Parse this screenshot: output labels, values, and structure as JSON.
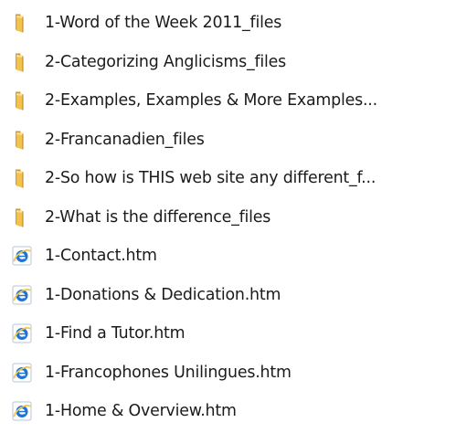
{
  "items": [
    {
      "name": "1-Word of the Week 2011_files",
      "icon": "folder-icon"
    },
    {
      "name": "2-Categorizing  Anglicisms_files",
      "icon": "folder-icon"
    },
    {
      "name": "2-Examples, Examples & More Examples...",
      "icon": "folder-icon"
    },
    {
      "name": "2-Francanadien_files",
      "icon": "folder-icon"
    },
    {
      "name": "2-So how is THIS web site any different_f...",
      "icon": "folder-icon"
    },
    {
      "name": "2-What is the difference_files",
      "icon": "folder-icon"
    },
    {
      "name": "1-Contact.htm",
      "icon": "internet-explorer-icon"
    },
    {
      "name": "1-Donations & Dedication.htm",
      "icon": "internet-explorer-icon"
    },
    {
      "name": "1-Find a Tutor.htm",
      "icon": "internet-explorer-icon"
    },
    {
      "name": "1-Francophones Unilingues.htm",
      "icon": "internet-explorer-icon"
    },
    {
      "name": "1-Home & Overview.htm",
      "icon": "internet-explorer-icon"
    }
  ],
  "colors": {
    "text": "#1b1b1b",
    "folder_front": "#f2c24f",
    "folder_back": "#d69a2a",
    "ie_blue": "#1e73d6",
    "ie_ring": "#f3c447",
    "page_bg": "#ffffff"
  }
}
